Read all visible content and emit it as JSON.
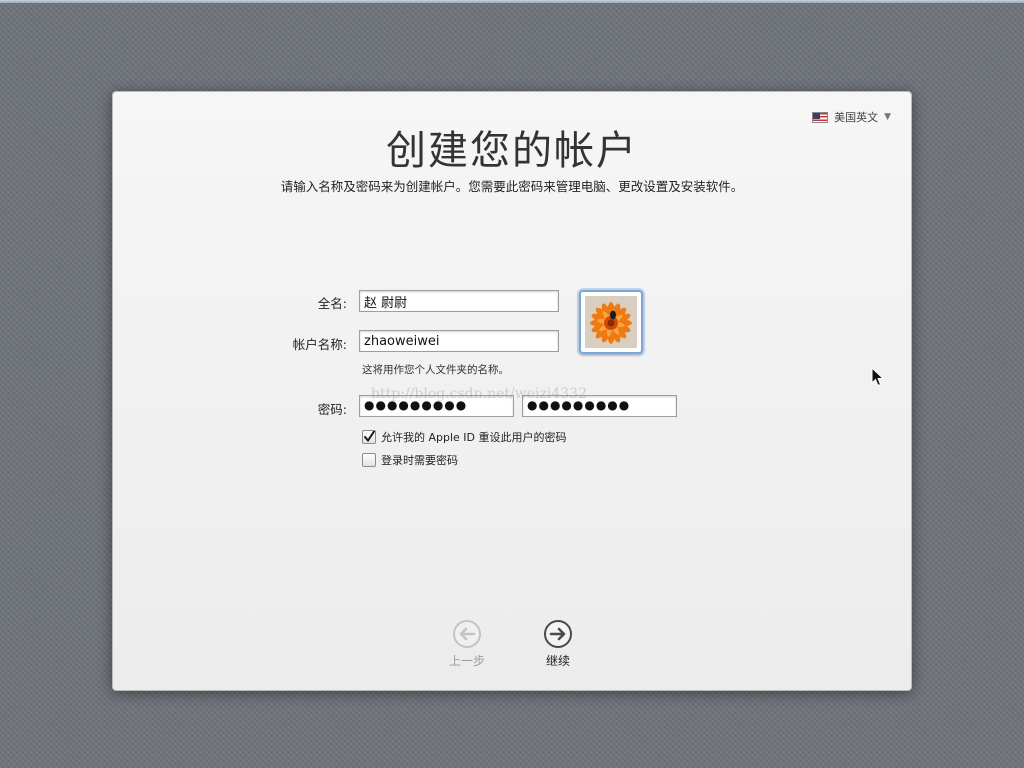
{
  "language_menu": {
    "label": "美国英文"
  },
  "header": {
    "title": "创建您的帐户",
    "subtitle": "请输入名称及密码来为创建帐户。您需要此密码来管理电脑、更改设置及安装软件。"
  },
  "form": {
    "full_name_label": "全名:",
    "full_name_value": "赵 尉尉",
    "account_name_label": "帐户名称:",
    "account_name_value": "zhaoweiwei",
    "account_hint": "这将用作您个人文件夹的名称。",
    "password_label": "密码:",
    "password_mask": "●●●●●●●●●",
    "verify_mask": "●●●●●●●●●"
  },
  "options": {
    "apple_id_reset": {
      "label": "允许我的 Apple ID 重设此用户的密码",
      "checked": true
    },
    "require_password_login": {
      "label": "登录时需要密码",
      "checked": false
    }
  },
  "watermark": "http://blog.csdn.net/weizi4332",
  "navigation": {
    "back_label": "上一步",
    "continue_label": "继续"
  },
  "avatar": {
    "icon": "orange-flower-photo"
  },
  "colors": {
    "accent": "#79a8d8",
    "background": "#6f737a",
    "panel": "#efefef"
  }
}
